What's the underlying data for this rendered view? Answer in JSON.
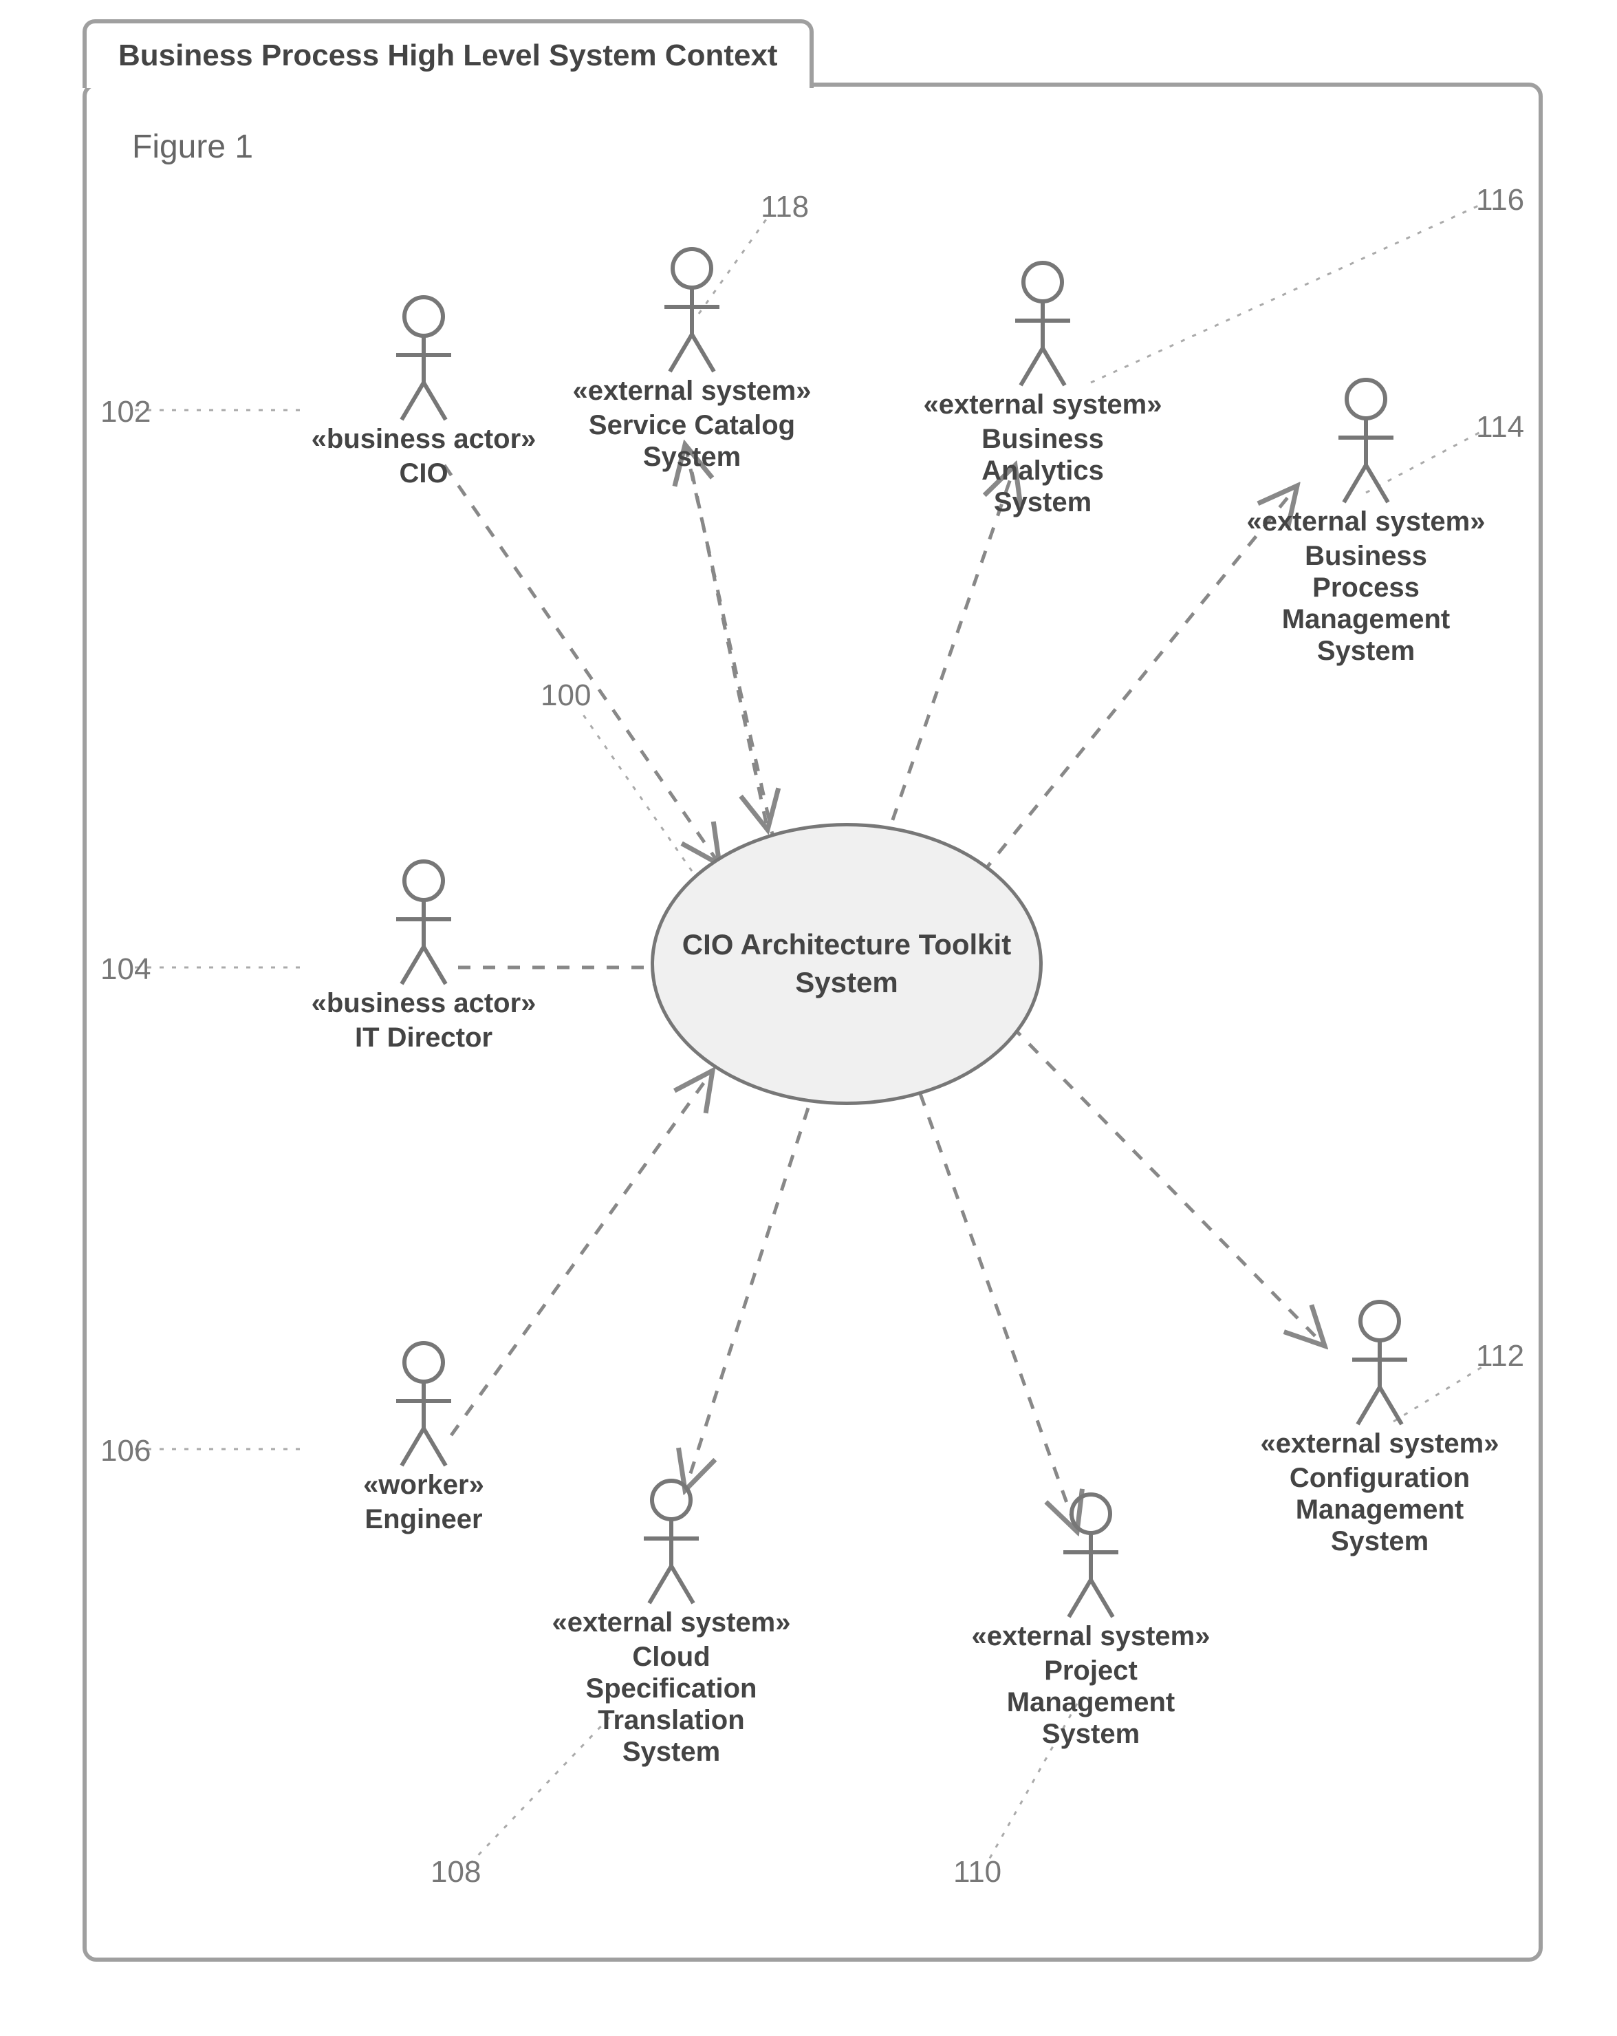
{
  "tab_title": "Business Process High Level System Context",
  "figure_caption": "Figure 1",
  "central": {
    "name_line1": "CIO Architecture Toolkit",
    "name_line2": "System"
  },
  "actors": {
    "cio": {
      "stereotype": "«business actor»",
      "name": "CIO"
    },
    "it": {
      "stereotype": "«business actor»",
      "name": "IT Director"
    },
    "eng": {
      "stereotype": "«worker»",
      "name": "Engineer"
    },
    "svc": {
      "stereotype": "«external system»",
      "name": "Service Catalog\nSystem"
    },
    "ba": {
      "stereotype": "«external system»",
      "name": "Business\nAnalytics\nSystem"
    },
    "bpm": {
      "stereotype": "«external system»",
      "name": "Business\nProcess\nManagement\nSystem"
    },
    "cms": {
      "stereotype": "«external system»",
      "name": "Configuration\nManagement\nSystem"
    },
    "pms": {
      "stereotype": "«external system»",
      "name": "Project\nManagement\nSystem"
    },
    "cloud": {
      "stereotype": "«external system»",
      "name": "Cloud\nSpecification\nTranslation\nSystem"
    }
  },
  "callouts": {
    "c100": "100",
    "c102": "102",
    "c104": "104",
    "c106": "106",
    "c108": "108",
    "c110": "110",
    "c112": "112",
    "c114": "114",
    "c116": "116",
    "c118": "118"
  }
}
